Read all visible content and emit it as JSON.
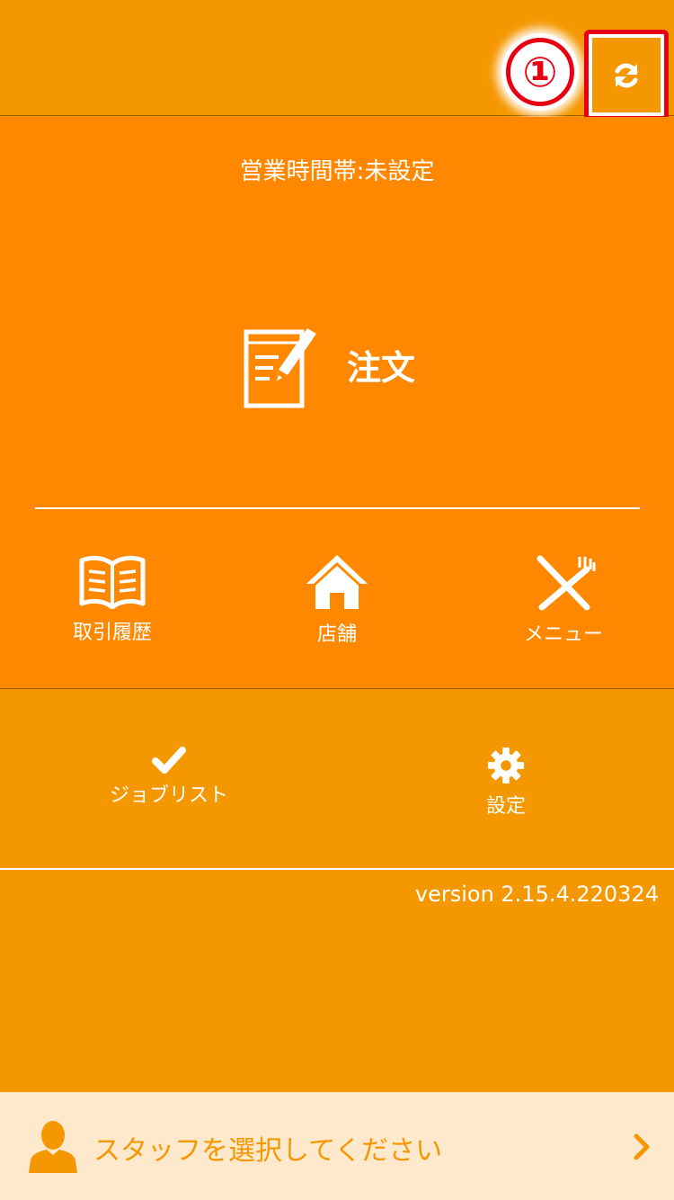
{
  "header": {
    "annotation_marker": "①",
    "refresh_icon": "refresh-icon"
  },
  "main": {
    "business_hours": "営業時間帯:未設定",
    "order_label": "注文",
    "nav": [
      {
        "label": "取引履歴",
        "icon": "book-icon"
      },
      {
        "label": "店舗",
        "icon": "home-icon"
      },
      {
        "label": "メニュー",
        "icon": "fork-knife-icon"
      }
    ]
  },
  "secondary": {
    "items": [
      {
        "label": "ジョブリスト",
        "icon": "check-icon"
      },
      {
        "label": "設定",
        "icon": "gear-icon"
      }
    ],
    "version": "version 2.15.4.220324"
  },
  "staff": {
    "placeholder": "スタッフを選択してください"
  },
  "colors": {
    "header_bg": "#F59700",
    "main_bg": "#FF8800",
    "staff_bg": "#FFE9CC",
    "staff_text": "#F59700",
    "annotation_red": "#E60012"
  }
}
